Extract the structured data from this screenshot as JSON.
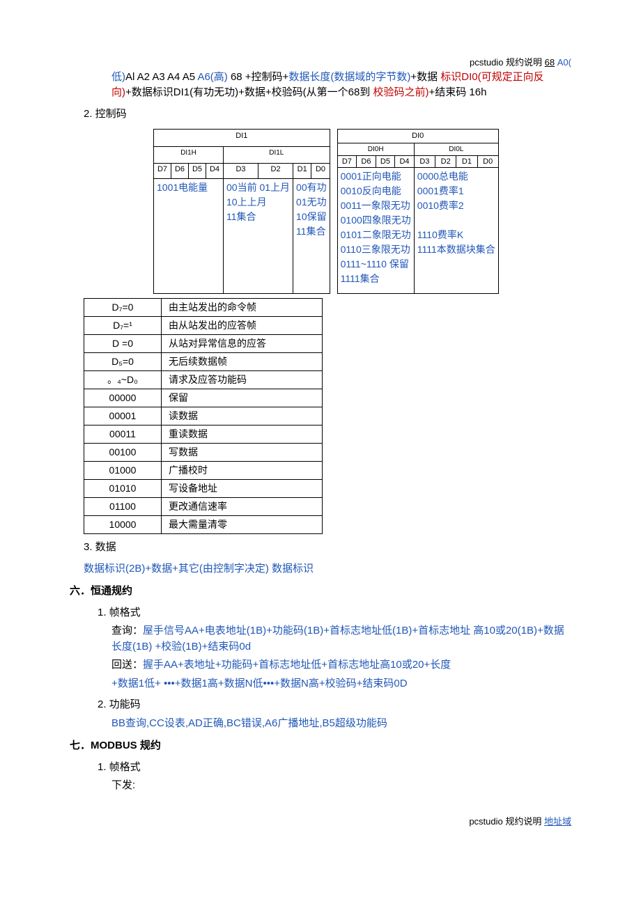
{
  "header": {
    "prefix": "pcstudio 规约说明",
    "suffix_u": "68",
    "suffix_blue": "A0("
  },
  "intro": {
    "p1a": "低)",
    "p1b": "Al A2 A3 A4 A5",
    "p1c": "A6(高)",
    "p1d": " 68 +控制码+",
    "p1e": "数据长度(数据域的字节数)",
    "p1f": "+数据",
    "p1g": " 标识DI0(可规定正向反向)",
    "p1h": "+数据标识DI1(有功无功)+数据+校验码(从第一个68到",
    "p1i": " 校验码之前)",
    "p1j": "+结束码 16h"
  },
  "sec2": "2. 控制码",
  "di1": {
    "title": "DI1",
    "subL": "DI1H",
    "subR": "DI1L",
    "cells": [
      "D7",
      "D6",
      "D5",
      "D4",
      "D3",
      "D2",
      "D1",
      "D0"
    ],
    "colL": "1001电能量",
    "colR1": "00当前 01上月\n10上上月\n11集合",
    "colR2": "00有功\n01无功\n10保留\n11集合"
  },
  "di0": {
    "title": "DI0",
    "subL": "DI0H",
    "subR": "DI0L",
    "cells": [
      "D7",
      "D6",
      "D5",
      "D4",
      "D3",
      "D2",
      "D1",
      "D0"
    ],
    "colL": "0001正向电能\n0010反向电能\n0011一象限无功\n0100四象限无功\n0101二象限无功\n0110三象限无功\n0111~1110 保留\n1111集合",
    "colR": "0000总电能\n0001费率1\n0010费率2\n\n1110费率K\n1111本数据块集合"
  },
  "ctrl": [
    {
      "k": "D₇=0",
      "v": "由主站发出的命令帧"
    },
    {
      "k": "D₇=¹",
      "v": "由从站发出的应答帧"
    },
    {
      "k": "D =0",
      "v": "从站对异常信息的应答"
    },
    {
      "k": "D₅=0",
      "v": "无后续数据帧"
    },
    {
      "k": "。₄~D₀",
      "v": "请求及应答功能码"
    },
    {
      "k": "00000",
      "v": "保留"
    },
    {
      "k": "00001",
      "v": "读数据"
    },
    {
      "k": "00011",
      "v": "重读数据"
    },
    {
      "k": "00100",
      "v": "写数据"
    },
    {
      "k": "01000",
      "v": "广播校时"
    },
    {
      "k": "01010",
      "v": "写设备地址"
    },
    {
      "k": "01100",
      "v": "更改通信速率"
    },
    {
      "k": "10000",
      "v": "最大需量清零"
    }
  ],
  "sec3": {
    "title": "3. 数据",
    "line": "数据标识(2B)+数据+其它(由控制字决定) 数据标识"
  },
  "h6": "六．恒通规约",
  "h6_1": "1. 帧格式",
  "h6_1_q": "查询：",
  "h6_1_qtxt": "屋手信号AA+电表地址(1B)+功能码(1B)+首标志地址低(1B)+首标志地址 高10或20(1B)+数据长度(1B) +校验(1B)+结束码0d",
  "h6_1_r": "回送：",
  "h6_1_rtxt": "握手AA+表地址+功能码+首标志地址低+首标志地址高10或20+长度",
  "h6_1_r2": "+数据1低+ •••+数据1高+数据N低•••+数据N高+校验码+结束码0D",
  "h6_2": "2. 功能码",
  "h6_2_txt": "BB查询,CC设表,AD正确,BC错误,A6广播地址,B5超级功能码",
  "h7": "七．MODBUS 规约",
  "h7_1": "1. 帧格式",
  "h7_1_txt": "下发:",
  "footer": {
    "prefix": "pcstudio 规约说明",
    "link": "地址域"
  }
}
